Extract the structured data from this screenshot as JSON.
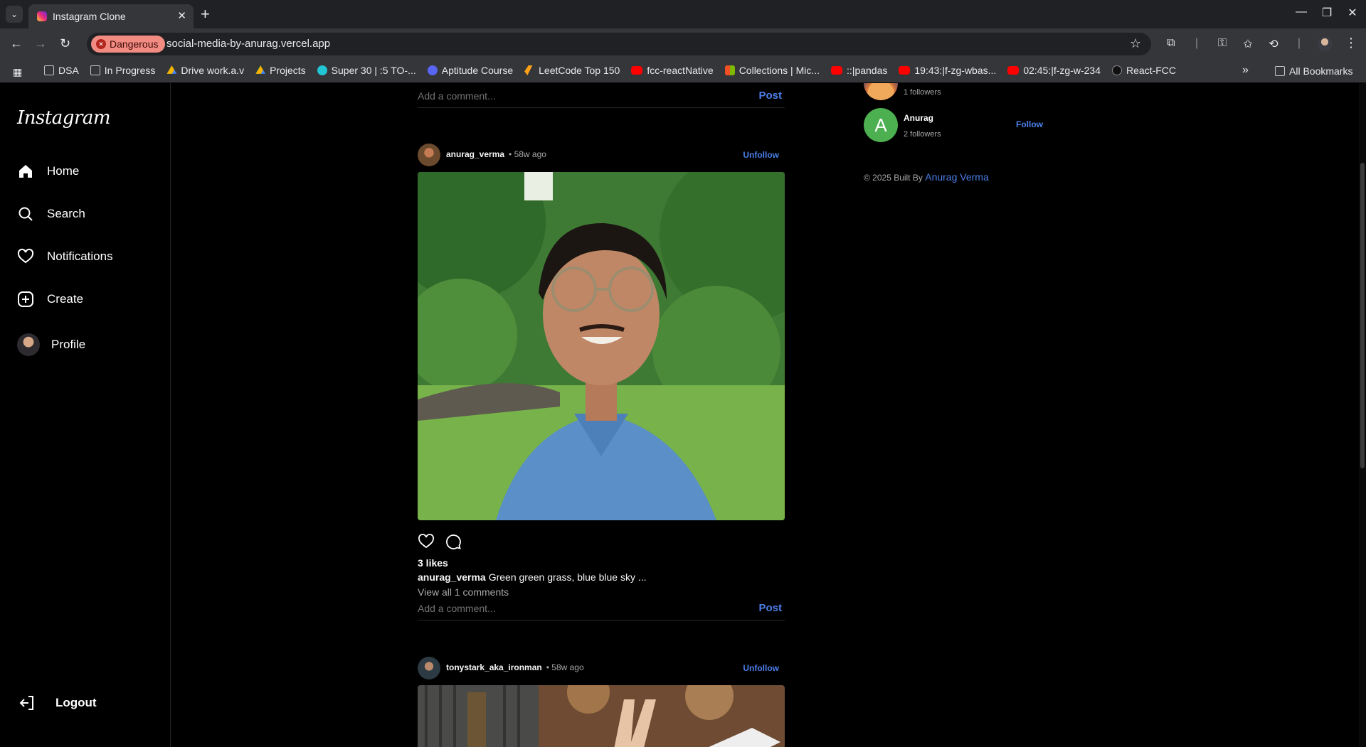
{
  "browser": {
    "tab_title": "Instagram Clone",
    "security_chip": "Dangerous",
    "url": "social-media-by-anurag.vercel.app",
    "bookmarks": [
      "DSA",
      "In Progress",
      "Drive work.a.v",
      "Projects",
      "Super 30 | :5 TO-...",
      "Aptitude Course",
      "LeetCode Top 150",
      "fcc-reactNative",
      "Collections | Mic...",
      "::|pandas",
      "19:43:|f-zg-wbas...",
      "02:45:|f-zg-w-234",
      "React-FCC"
    ],
    "all_bookmarks": "All Bookmarks"
  },
  "sidebar": {
    "logo": "Instagram",
    "items": [
      {
        "label": "Home",
        "icon": "home-icon"
      },
      {
        "label": "Search",
        "icon": "search-icon"
      },
      {
        "label": "Notifications",
        "icon": "heart-icon"
      },
      {
        "label": "Create",
        "icon": "plus-square-icon"
      },
      {
        "label": "Profile",
        "icon": "avatar"
      }
    ],
    "logout": "Logout"
  },
  "feed": {
    "comment_placeholder": "Add a comment...",
    "post_label": "Post",
    "posts": [
      {
        "username": "anurag_verma",
        "time": "• 58w ago",
        "action": "Unfollow",
        "likes": "3 likes",
        "caption_user": "anurag_verma",
        "caption": "Green green grass, blue blue sky ...",
        "view_comments": "View all 1 comments"
      },
      {
        "username": "tonystark_aka_ironman",
        "time": "• 58w ago",
        "action": "Unfollow"
      }
    ]
  },
  "suggestions": {
    "items": [
      {
        "name": "",
        "followers": "1 followers"
      },
      {
        "name": "Anurag",
        "initial": "A",
        "followers": "2 followers",
        "action": "Follow"
      }
    ],
    "footer_prefix": "© 2025 Built By",
    "footer_link": "Anurag Verma"
  }
}
